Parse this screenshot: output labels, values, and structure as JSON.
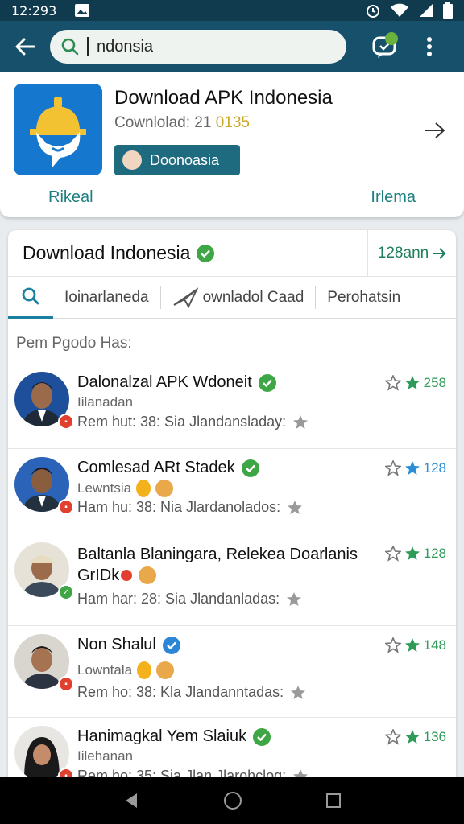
{
  "status_bar": {
    "time": "12:293",
    "icons": [
      "image-icon",
      "alarm-icon",
      "wifi-icon",
      "signal-icon",
      "battery-icon"
    ]
  },
  "app_bar": {
    "back_icon": "back-arrow-icon",
    "search": {
      "value": "ndonsia",
      "placeholder": ""
    },
    "notification_badge": "",
    "menu_icon": "more-vert-icon"
  },
  "app_card": {
    "title": "Download APK Indonesia",
    "downloads_label": "Cownlolad: 21",
    "downloads_count": "0135",
    "chip_label": "Doonoasia",
    "left_link": "Rikeal",
    "right_link": "Irlema"
  },
  "results": {
    "title": "Download Indonesia",
    "header_link": "128ann",
    "tabs": [
      {
        "label": "Ioinarlaneda",
        "icon": "search-icon"
      },
      {
        "label": "ownladol Caad",
        "icon": "plane-icon"
      },
      {
        "label": "Perohatsin",
        "icon": ""
      }
    ],
    "section_label": "Pem Pgodo Has:",
    "items": [
      {
        "name": "Dalonalzal APK Wdoneit",
        "verified_color": "#3fa646",
        "sub": "Iilanadan",
        "meta": "Rem hut: 38: Sia Jlandansladay:",
        "rating": "258",
        "rating_color": "#2e9b58",
        "badge_color": "#e2402f"
      },
      {
        "name": "Comlesad ARt Stadek",
        "verified_color": "#3fa646",
        "sub": "Lewntsia",
        "meta": "Ham hu: 38: Nia Jlardanolados:",
        "rating": "128",
        "rating_color": "#2a8fd8",
        "badge_color": "#e2402f"
      },
      {
        "name": "Baltanla Blaningara, Relekea Doarlanis",
        "name2": "GrIDk",
        "verified_color": "#3fa646",
        "sub": "",
        "meta": "Ham har: 28: Sia Jlandanladas:",
        "rating": "128",
        "rating_color": "#2e9b58",
        "badge_color": "#3fa646"
      },
      {
        "name": "Non Shalul",
        "verified_color": "#2b86d6",
        "sub": "Lowntala",
        "meta": "Rem ho: 38: Kla Jlandanntadas:",
        "rating": "148",
        "rating_color": "#2e9b58",
        "badge_color": "#e2402f"
      },
      {
        "name": "Hanimagkal Yem Slaiuk",
        "verified_color": "#3fa646",
        "sub": "Iilehanan",
        "meta": "Rem ho: 35: Sia Jlan Jlarohclog:",
        "rating": "136",
        "rating_color": "#2e9b58",
        "badge_color": "#e2402f"
      }
    ]
  },
  "nav_bar": {
    "icons": [
      "back-triangle-icon",
      "home-circle-icon",
      "recents-square-icon"
    ]
  }
}
